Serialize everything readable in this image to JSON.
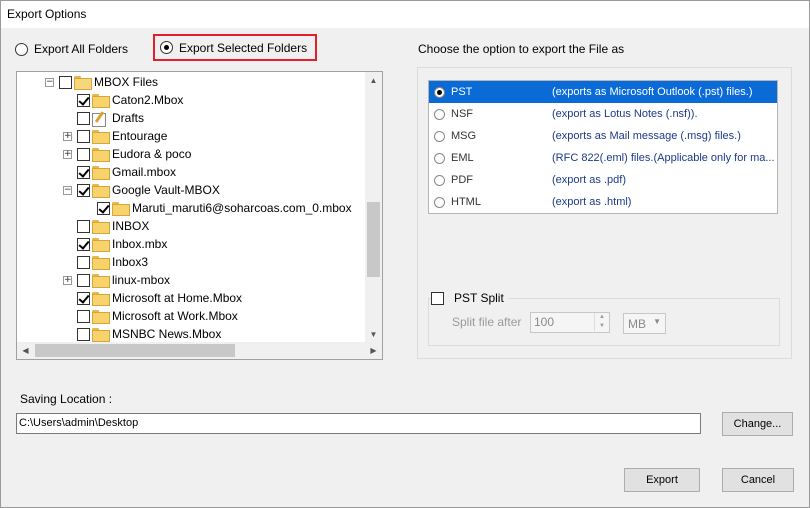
{
  "window": {
    "title": "Export Options"
  },
  "export_mode": {
    "all_label": "Export All Folders",
    "selected_label": "Export Selected Folders",
    "selected": "selected"
  },
  "tree": {
    "root": {
      "label": "MBOX Files",
      "checked": false,
      "expanded": true
    },
    "items": [
      {
        "label": "Caton2.Mbox",
        "checked": true,
        "icon": "folder-icon"
      },
      {
        "label": "Drafts",
        "checked": false,
        "icon": "drafts-icon"
      },
      {
        "label": "Entourage",
        "checked": false,
        "icon": "folder-icon",
        "expander": "+"
      },
      {
        "label": "Eudora & poco",
        "checked": false,
        "icon": "folder-icon",
        "expander": "+"
      },
      {
        "label": "Gmail.mbox",
        "checked": true,
        "icon": "folder-icon"
      },
      {
        "label": "Google Vault-MBOX",
        "checked": true,
        "icon": "folder-icon",
        "expander": "−"
      },
      {
        "label": "Maruti_maruti6@soharcoas.com_0.mbox",
        "checked": true,
        "icon": "folder-icon",
        "child": true
      },
      {
        "label": "INBOX",
        "checked": false,
        "icon": "folder-icon"
      },
      {
        "label": "Inbox.mbx",
        "checked": true,
        "icon": "folder-icon"
      },
      {
        "label": "Inbox3",
        "checked": false,
        "icon": "folder-icon"
      },
      {
        "label": "linux-mbox",
        "checked": false,
        "icon": "folder-icon",
        "expander": "+"
      },
      {
        "label": "Microsoft at Home.Mbox",
        "checked": true,
        "icon": "folder-icon"
      },
      {
        "label": "Microsoft at Work.Mbox",
        "checked": false,
        "icon": "folder-icon"
      },
      {
        "label": "MSNBC News.Mbox",
        "checked": false,
        "icon": "folder-icon"
      }
    ]
  },
  "format_panel": {
    "heading": "Choose the option to export the File as",
    "options": [
      {
        "format": "PST",
        "description": "(exports as Microsoft Outlook (.pst) files.)",
        "selected": true
      },
      {
        "format": "NSF",
        "description": "(export as Lotus Notes (.nsf)).",
        "selected": false
      },
      {
        "format": "MSG",
        "description": "(exports as Mail message (.msg) files.)",
        "selected": false
      },
      {
        "format": "EML",
        "description": "(RFC 822(.eml) files.(Applicable only for ma...",
        "selected": false
      },
      {
        "format": "PDF",
        "description": "(export as .pdf)",
        "selected": false
      },
      {
        "format": "HTML",
        "description": "(export as .html)",
        "selected": false
      }
    ]
  },
  "pst_split": {
    "label": "PST Split",
    "checked": false,
    "split_label": "Split file after",
    "value": "100",
    "unit": "MB"
  },
  "saving": {
    "label": "Saving Location :",
    "path": "C:\\Users\\admin\\Desktop",
    "change_label": "Change..."
  },
  "buttons": {
    "export_label": "Export",
    "cancel_label": "Cancel"
  },
  "colors": {
    "highlight": "#0a6ad6",
    "red_box": "#e0202a"
  }
}
